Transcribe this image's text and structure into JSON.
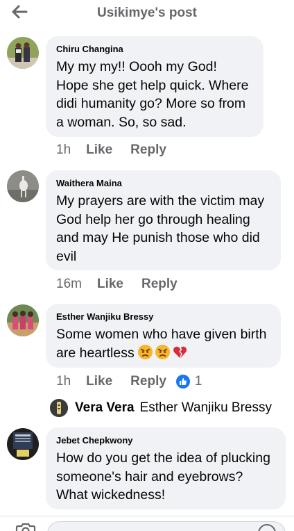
{
  "header": {
    "title": "Usikimye's post"
  },
  "comments": [
    {
      "author": "Chiru Changina",
      "text": "My my my!! Oooh my God! Hope she get help quick. Where didi humanity go? More so from a woman. So, so sad.",
      "time": "1h",
      "like_label": "Like",
      "reply_label": "Reply"
    },
    {
      "author": "Waithera Maina",
      "text": "My prayers are with the victim may God help her go through healing and may He punish those who did evil",
      "time": "16m",
      "like_label": "Like",
      "reply_label": "Reply"
    },
    {
      "author": "Esther Wanjiku Bressy",
      "text": "Some women who have given birth are heartless",
      "emojis": [
        "angry-face-icon",
        "angry-face-icon",
        "broken-heart-icon"
      ],
      "time": "1h",
      "like_label": "Like",
      "reply_label": "Reply",
      "reaction_count": "1",
      "reply_preview": {
        "author": "Vera Vera",
        "text": "Esther Wanjiku Bressy"
      }
    },
    {
      "author": "Jebet Chepkwony",
      "text": "How do you get the idea of plucking someone's hair and eyebrows? What wickedness!"
    }
  ],
  "colors": {
    "bubble": "#f0f2f5",
    "secondary_text": "#65676b",
    "like_blue": "#1877f2"
  }
}
